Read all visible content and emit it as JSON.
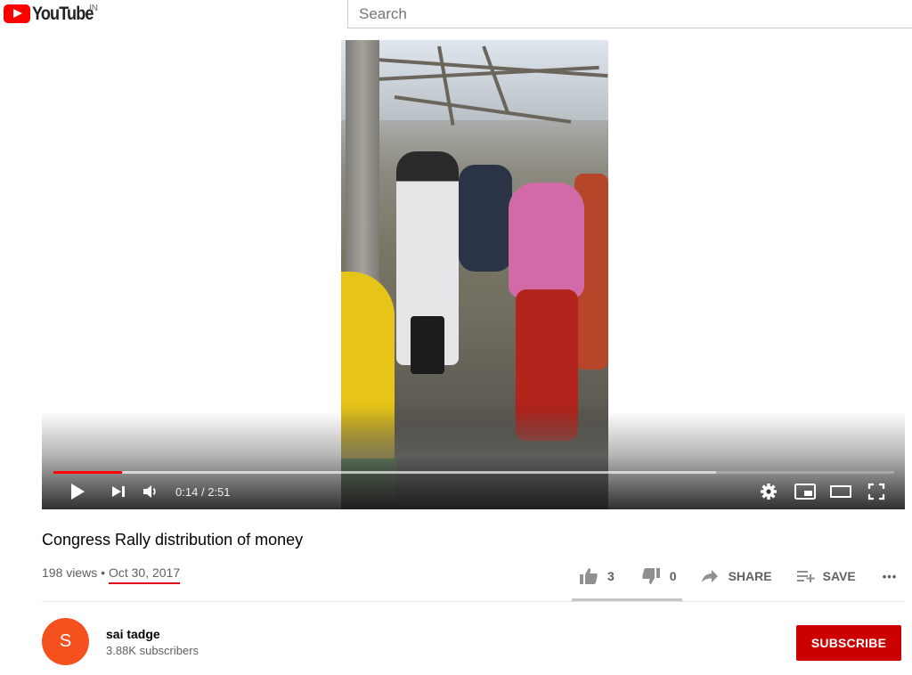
{
  "header": {
    "logo_text": "YouTube",
    "country_code": "IN",
    "search_placeholder": "Search"
  },
  "player": {
    "time_current": "0:14",
    "time_separator": "/",
    "time_total": "2:51",
    "progress_played_fraction": 0.082,
    "progress_loaded_fraction": 0.788,
    "icons": [
      "play-icon",
      "next-icon",
      "volume-icon",
      "settings-icon",
      "miniplayer-icon",
      "theater-mode-icon",
      "fullscreen-icon"
    ]
  },
  "video": {
    "title": "Congress Rally distribution of money",
    "views": "198 views",
    "separator": "•",
    "date": "Oct 30, 2017"
  },
  "actions": {
    "likes": "3",
    "dislikes": "0",
    "share_label": "SHARE",
    "save_label": "SAVE",
    "more_label": "•••"
  },
  "channel": {
    "avatar_letter": "S",
    "name": "sai tadge",
    "subscribers": "3.88K subscribers",
    "subscribe_label": "SUBSCRIBE"
  },
  "colors": {
    "brand_red": "#ff0000",
    "subscribe_red": "#cc0000",
    "avatar_orange": "#f4511e",
    "text_primary": "#030303",
    "text_secondary": "#606060"
  }
}
